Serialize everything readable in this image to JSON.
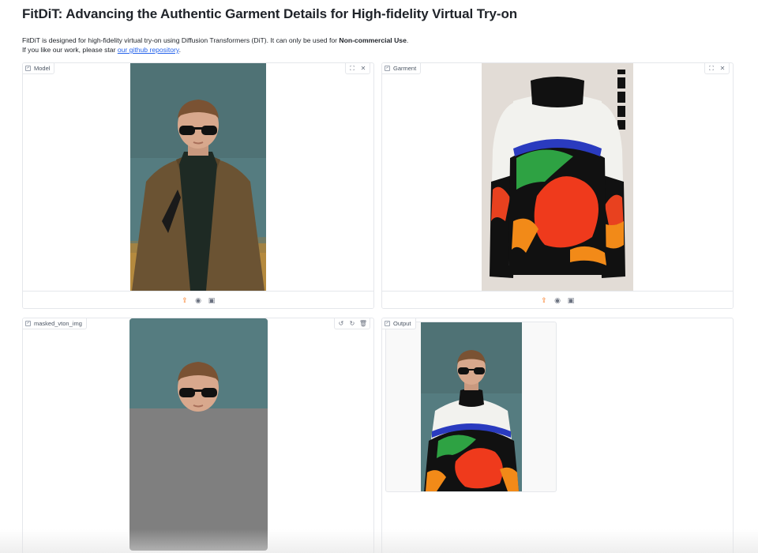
{
  "page": {
    "title": "FitDiT: Advancing the Authentic Garment Details for High-fidelity Virtual Try-on",
    "desc_line1_pre": "FitDiT is designed for high-fidelity virtual try-on using Diffusion Transformers (DiT). It can only be used for ",
    "desc_line1_bold": "Non-commercial Use",
    "desc_line1_post": ".",
    "desc_line2_pre": "If you like our work, please star ",
    "desc_line2_link": "our github repository",
    "desc_line2_post": "."
  },
  "panels": {
    "model": {
      "label": "Model"
    },
    "garment": {
      "label": "Garment"
    },
    "masked": {
      "label": "masked_vton_img"
    },
    "output": {
      "label": "Output"
    }
  },
  "icons": {
    "image_label": "image-icon",
    "fullscreen": "fullscreen-icon",
    "close": "close-icon",
    "undo": "undo-icon",
    "redo": "redo-icon",
    "delete": "trash-icon",
    "upload": "upload-icon",
    "webcam": "webcam-icon",
    "clipboard": "clipboard-icon"
  },
  "colors": {
    "accent_upload": "#f97316",
    "link": "#2563eb",
    "model_bg": "#557c80",
    "coat": "#6b5333",
    "mask_gray": "#7f7f7f"
  }
}
